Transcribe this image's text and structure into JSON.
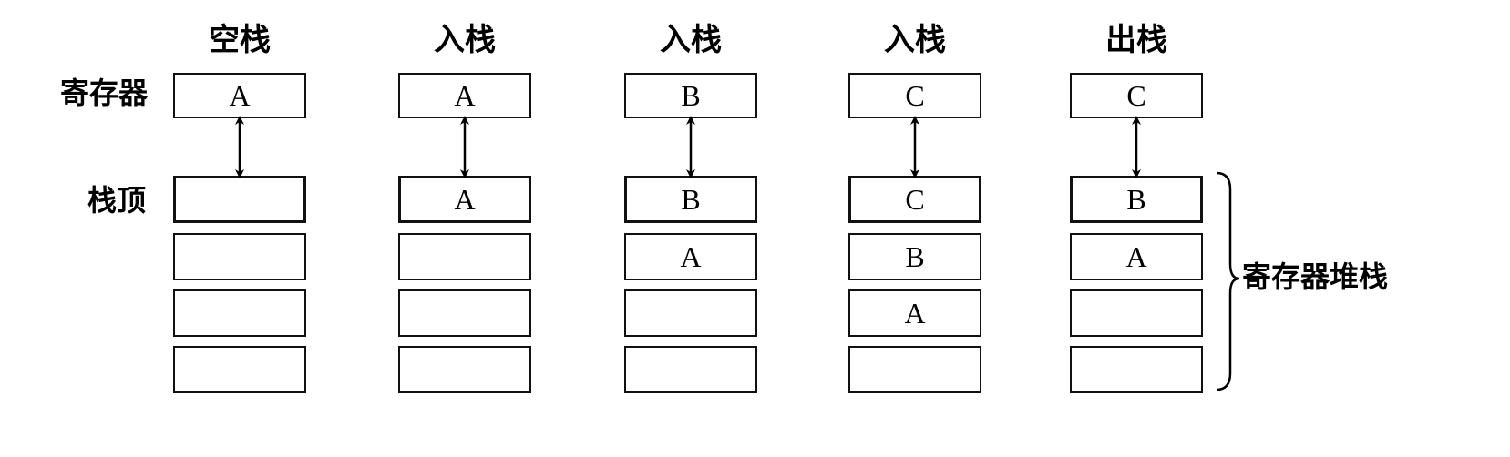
{
  "columns": [
    {
      "title": "空栈",
      "register": "A",
      "stack": [
        "",
        "",
        "",
        ""
      ]
    },
    {
      "title": "入栈",
      "register": "A",
      "stack": [
        "A",
        "",
        "",
        ""
      ]
    },
    {
      "title": "入栈",
      "register": "B",
      "stack": [
        "B",
        "A",
        "",
        ""
      ]
    },
    {
      "title": "入栈",
      "register": "C",
      "stack": [
        "C",
        "B",
        "A",
        ""
      ]
    },
    {
      "title": "出栈",
      "register": "C",
      "stack": [
        "B",
        "A",
        "",
        ""
      ]
    }
  ],
  "labels": {
    "register": "寄存器",
    "stack_top": "栈顶",
    "register_stack": "寄存器堆栈"
  }
}
